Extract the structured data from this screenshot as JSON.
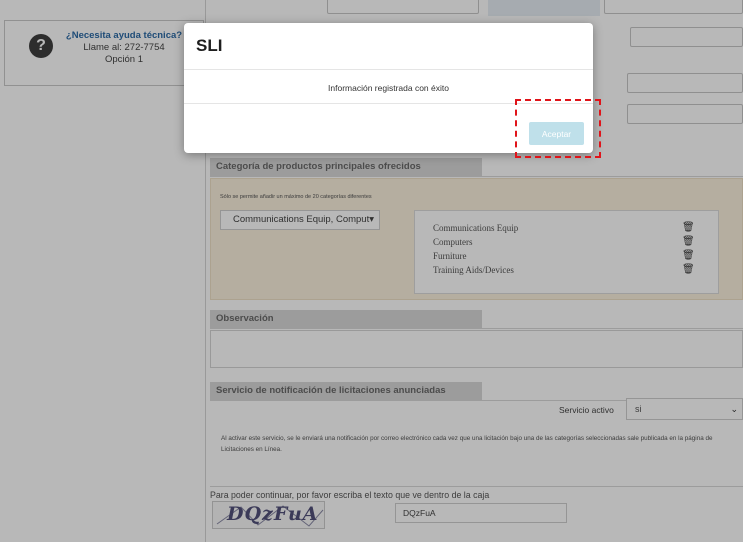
{
  "help": {
    "icon": "question-circle-icon",
    "title": "¿Necesita ayuda técnica?",
    "phone": "Llame al: 272-7754",
    "option": "Opción 1"
  },
  "categories": {
    "header": "Categoría de productos principales ofrecidos",
    "hint": "Sólo se permite añadir un máximo de 20 categorías diferentes",
    "select_value": "Communications Equip, Comput▾",
    "items": [
      "Communications Equip",
      "Computers",
      "Furniture",
      "Training Aids/Devices"
    ],
    "delete_icon": "trash-icon"
  },
  "observations": {
    "header": "Observación",
    "value": ""
  },
  "notifications": {
    "header": "Servicio de notificación de licitaciones anunciadas",
    "active_label": "Servicio activo",
    "active_value": "si",
    "description": "Al activar este servicio, se le enviará una notificación por correo electrónico cada vez que una licitación bajo una de las categorías seleccionadas sale publicada en la página de Licitaciones en Línea."
  },
  "captcha": {
    "hint": "Para poder continuar, por favor escriba el texto que ve dentro de la caja",
    "image_text": "DQzFuA",
    "input_value": "DQzFuA"
  },
  "modal": {
    "title": "SLI",
    "message": "Información registrada con éxito",
    "accept_label": "Aceptar"
  },
  "colors": {
    "highlight": "#e0141a",
    "accept_button": "#bfe0ea",
    "category_panel": "#fbf1de"
  }
}
